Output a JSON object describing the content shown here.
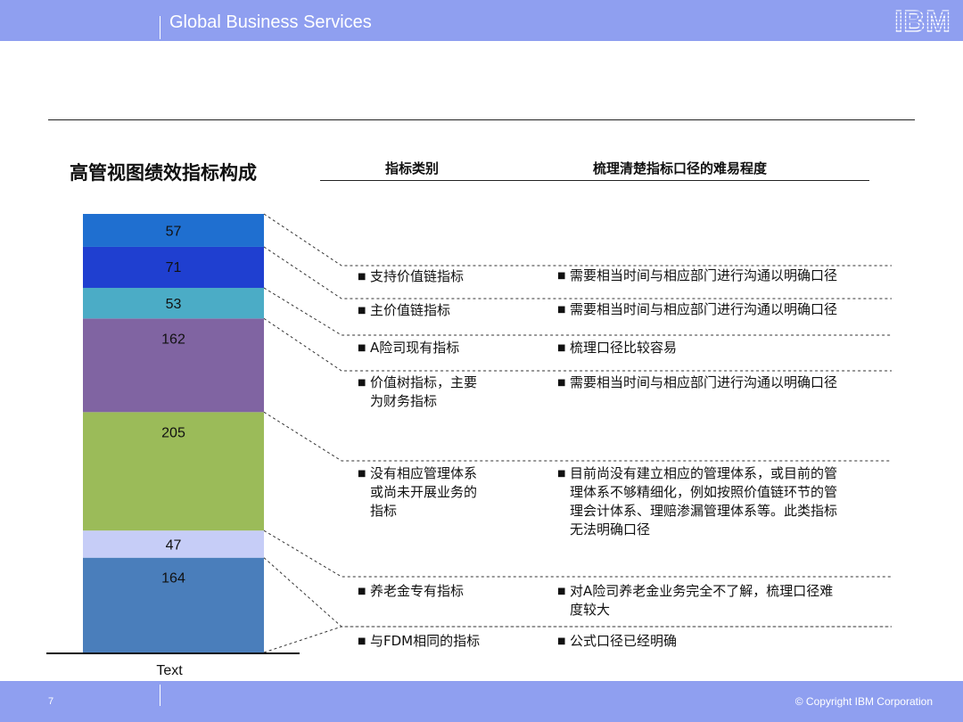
{
  "header": {
    "title": "Global Business Services",
    "logo_text": "IBM"
  },
  "slide": {
    "title": "高管视图绩效指标构成"
  },
  "table": {
    "col1_header": "指标类别",
    "col2_header": "梳理清楚指标口径的难易程度",
    "rows": [
      {
        "category": [
          "支持价值链指标"
        ],
        "difficulty": [
          "需要相当时间与相应部门进行沟通以明确口径"
        ]
      },
      {
        "category": [
          "主价值链指标"
        ],
        "difficulty": [
          "需要相当时间与相应部门进行沟通以明确口径"
        ]
      },
      {
        "category": [
          "A险司现有指标"
        ],
        "difficulty": [
          "梳理口径比较容易"
        ]
      },
      {
        "category": [
          "价值树指标，主要",
          "为财务指标"
        ],
        "difficulty": [
          "需要相当时间与相应部门进行沟通以明确口径"
        ]
      },
      {
        "category": [
          "没有相应管理体系",
          "或尚未开展业务的",
          "指标"
        ],
        "difficulty": [
          "目前尚没有建立相应的管理体系，或目前的管",
          "理体系不够精细化，例如按照价值链环节的管",
          "理会计体系、理赔渗漏管理体系等。此类指标",
          "无法明确口径"
        ]
      },
      {
        "category": [
          "养老金专有指标"
        ],
        "difficulty": [
          "对A险司养老金业务完全不了解，梳理口径难",
          "度较大"
        ]
      },
      {
        "category": [
          "与FDM相同的指标"
        ],
        "difficulty": [
          "公式口径已经明确"
        ]
      }
    ]
  },
  "chart_data": {
    "type": "bar",
    "stacked": true,
    "categories": [
      "Text"
    ],
    "series": [
      {
        "values": [
          164
        ],
        "color": "#4a7ebb"
      },
      {
        "values": [
          47
        ],
        "color": "#c6cdf7"
      },
      {
        "values": [
          205
        ],
        "color": "#9bbb59"
      },
      {
        "values": [
          162
        ],
        "color": "#8064a2"
      },
      {
        "values": [
          53
        ],
        "color": "#4bacc6"
      },
      {
        "values": [
          71
        ],
        "color": "#1f3fd0"
      },
      {
        "values": [
          57
        ],
        "color": "#1f6fd0"
      }
    ]
  },
  "footer": {
    "page_number": "7",
    "copyright": "© Copyright IBM Corporation"
  }
}
